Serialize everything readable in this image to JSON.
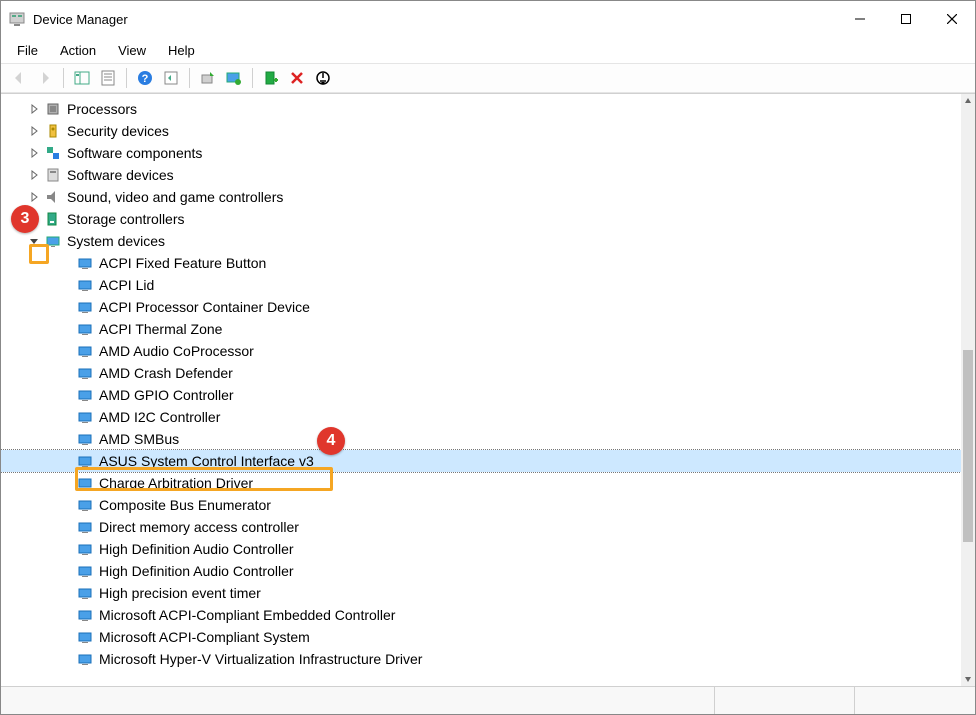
{
  "window": {
    "title": "Device Manager"
  },
  "menu": {
    "file": "File",
    "action": "Action",
    "view": "View",
    "help": "Help"
  },
  "categories": [
    {
      "label": "Processors",
      "icon": "cpu",
      "expanded": false
    },
    {
      "label": "Security devices",
      "icon": "security",
      "expanded": false
    },
    {
      "label": "Software components",
      "icon": "software-comp",
      "expanded": false
    },
    {
      "label": "Software devices",
      "icon": "software-dev",
      "expanded": false
    },
    {
      "label": "Sound, video and game controllers",
      "icon": "sound",
      "expanded": false
    },
    {
      "label": "Storage controllers",
      "icon": "storage",
      "expanded": false
    },
    {
      "label": "System devices",
      "icon": "system",
      "expanded": true
    }
  ],
  "system_devices": [
    "ACPI Fixed Feature Button",
    "ACPI Lid",
    "ACPI Processor Container Device",
    "ACPI Thermal Zone",
    "AMD Audio CoProcessor",
    "AMD Crash Defender",
    "AMD GPIO Controller",
    "AMD I2C Controller",
    "AMD SMBus",
    "ASUS System Control Interface v3",
    "Charge Arbitration Driver",
    "Composite Bus Enumerator",
    "Direct memory access controller",
    "High Definition Audio Controller",
    "High Definition Audio Controller",
    "High precision event timer",
    "Microsoft ACPI-Compliant Embedded Controller",
    "Microsoft ACPI-Compliant System",
    "Microsoft Hyper-V Virtualization Infrastructure Driver"
  ],
  "selected_device_index": 9,
  "annotations": {
    "callout3": "3",
    "callout4": "4"
  }
}
